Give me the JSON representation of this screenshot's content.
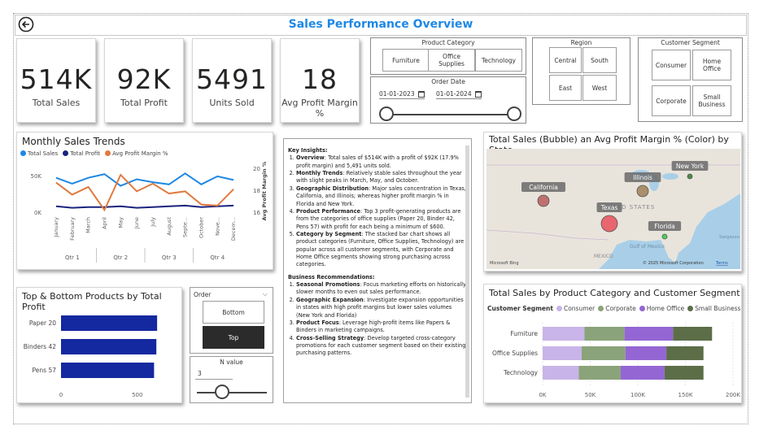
{
  "header": {
    "title": "Sales Performance Overview",
    "back_icon": "back-arrow-icon"
  },
  "kpis": [
    {
      "value": "514K",
      "label": "Total Sales"
    },
    {
      "value": "92K",
      "label": "Total Profit"
    },
    {
      "value": "5491",
      "label": "Units Sold"
    },
    {
      "value": "18",
      "label": "Avg Profit Margin %"
    }
  ],
  "category_slicer": {
    "title": "Product Category",
    "options": [
      "Furniture",
      "Office Supplies",
      "Technology"
    ]
  },
  "date_slicer": {
    "title": "Order Date",
    "start": "01-01-2023",
    "end": "01-01-2024"
  },
  "region_slicer": {
    "title": "Region",
    "options": [
      "Central",
      "South",
      "East",
      "West"
    ]
  },
  "segment_slicer": {
    "title": "Customer Segment",
    "options": [
      "Consumer",
      "Home Office",
      "Corporate",
      "Small Business"
    ]
  },
  "monthly": {
    "title": "Monthly Sales Trends",
    "legend": [
      "Total Sales",
      "Total Profit",
      "Avg Profit Margin %"
    ],
    "y_left_ticks": [
      "50K",
      "0K"
    ],
    "y_right_ticks": [
      "20",
      "18",
      "16"
    ],
    "y_right_label": "Avg Profit Margin %",
    "months": [
      "January",
      "February",
      "March",
      "April",
      "May",
      "June",
      "July",
      "August",
      "Septe...",
      "October",
      "Nove...",
      "Decem..."
    ],
    "quarters": [
      "Qtr 1",
      "Qtr 2",
      "Qtr 3",
      "Qtr 4"
    ]
  },
  "insights": {
    "heading1": "Key Insights:",
    "items1": [
      {
        "label": "Overview",
        "text": ": Total sales of $514K with a profit of $92K (17.9% profit margin) and 5,491 units sold."
      },
      {
        "label": "Monthly Trends",
        "text": ": Relatively stable sales throughout the year with slight peaks in March, May, and October."
      },
      {
        "label": "Geographic Distribution",
        "text": ": Major sales concentration in Texas, California, and Illinois; whereas higher profit margin % in Florida and New York."
      },
      {
        "label": "Product Performance",
        "text": ": Top 3 profit-generating products are from the categories of office supplies (Paper 20, Binder 42, Pens 57) with profit for each being a minimum of $600."
      },
      {
        "label": "Category by Segment",
        "text": ": The stacked bar chart shows all product categories (Furniture, Office Supplies, Technology) are popular across all customer segments, with Corporate and Home Office segments showing strong purchasing across categories."
      }
    ],
    "heading2": "Business Recommendations:",
    "items2": [
      {
        "label": "Seasonal Promotions",
        "text": ": Focus marketing efforts on historically slower months to even out sales performance."
      },
      {
        "label": "Geographic Expansion",
        "text": ": Investigate expansion opportunities in states with high profit margins but lower sales volumes (New York and Florida)"
      },
      {
        "label": "Product Focus",
        "text": ": Leverage high-profit items like Papers & Binders in marketing campaigns."
      },
      {
        "label": "Cross-Selling Strategy",
        "text": ": Develop targeted cross-category promotions for each customer segment based on their existing purchasing patterns."
      }
    ]
  },
  "map": {
    "title": "Total Sales (Bubble) an Avg Profit Margin % (Color) by State",
    "states": [
      "California",
      "Illinois",
      "New York",
      "Texas",
      "Florida"
    ],
    "country_label": "UNITED STATES",
    "mexico_label": "MEXICO",
    "gulf_label": "Gulf of Mexico",
    "sargasso_label": "Sargasso",
    "copyright": "© 2025 Microsoft Corporation",
    "terms": "Terms",
    "bing": "Microsoft Bing"
  },
  "top_bottom": {
    "title": "Top & Bottom Products by Total Profit",
    "x_ticks": [
      "0",
      "500"
    ]
  },
  "order_slicer": {
    "title": "Order",
    "options": [
      "Bottom",
      "Top"
    ],
    "selected": "Top"
  },
  "n_value": {
    "title": "N value",
    "value": "3"
  },
  "stacked": {
    "title": "Total Sales by Product Category and Customer Segment",
    "legend_title": "Customer Segment",
    "x_ticks": [
      "0K",
      "50K",
      "100K",
      "150K",
      "200K"
    ]
  },
  "chart_data": [
    {
      "type": "line",
      "title": "Monthly Sales Trends",
      "x": [
        "January",
        "February",
        "March",
        "April",
        "May",
        "June",
        "July",
        "August",
        "September",
        "October",
        "November",
        "December"
      ],
      "series": [
        {
          "name": "Total Sales",
          "axis": "left",
          "values": [
            47000,
            39000,
            47000,
            52000,
            36000,
            45000,
            41000,
            38000,
            53000,
            38000,
            49000,
            44000
          ],
          "color": "#1e88e5"
        },
        {
          "name": "Total Profit",
          "axis": "left",
          "values": [
            8000,
            6000,
            7000,
            7000,
            8000,
            6000,
            7000,
            8000,
            9000,
            7000,
            8000,
            9000
          ],
          "color": "#1a237e"
        },
        {
          "name": "Avg Profit Margin %",
          "axis": "right",
          "values": [
            18.7,
            17.6,
            18.3,
            16.2,
            19.4,
            17.9,
            18.6,
            17.7,
            17.9,
            16.7,
            16.6,
            18.1
          ],
          "color": "#e07a3f"
        }
      ],
      "ylim_left": [
        0,
        60000
      ],
      "ylim_right": [
        16,
        20
      ]
    },
    {
      "type": "bar",
      "orientation": "horizontal",
      "title": "Top & Bottom Products by Total Profit",
      "categories": [
        "Paper 20",
        "Binders 42",
        "Pens 57"
      ],
      "values": [
        630,
        625,
        610
      ],
      "xlim": [
        0,
        720
      ],
      "color": "#1428a0"
    },
    {
      "type": "bar",
      "orientation": "horizontal",
      "stacked": true,
      "title": "Total Sales by Product Category and Customer Segment",
      "categories": [
        "Furniture",
        "Office Supplies",
        "Technology"
      ],
      "series": [
        {
          "name": "Consumer",
          "values": [
            44000,
            41000,
            38000
          ],
          "color": "#c8b4e8"
        },
        {
          "name": "Corporate",
          "values": [
            42000,
            46000,
            44000
          ],
          "color": "#8aa37a"
        },
        {
          "name": "Home Office",
          "values": [
            51000,
            43000,
            46000
          ],
          "color": "#9466d4"
        },
        {
          "name": "Small Business",
          "values": [
            41000,
            39000,
            41000
          ],
          "color": "#5c6e48"
        }
      ],
      "xlim": [
        0,
        200000
      ]
    },
    {
      "type": "scatter",
      "title": "Total Sales (Bubble) an Avg Profit Margin % (Color) by State",
      "points": [
        {
          "label": "California",
          "size": "medium",
          "color": "#b85c5c"
        },
        {
          "label": "Illinois",
          "size": "medium",
          "color": "#a08058"
        },
        {
          "label": "New York",
          "size": "small",
          "color": "#2e7d32"
        },
        {
          "label": "Texas",
          "size": "large",
          "color": "#e8505b"
        },
        {
          "label": "Florida",
          "size": "small",
          "color": "#2ecc40"
        }
      ]
    }
  ],
  "colors": {
    "title_blue": "#1e88e5",
    "product_bar": "#1428a0",
    "sales_line": "#1e88e5",
    "profit_line": "#1a237e",
    "margin_line": "#e07a3f"
  }
}
